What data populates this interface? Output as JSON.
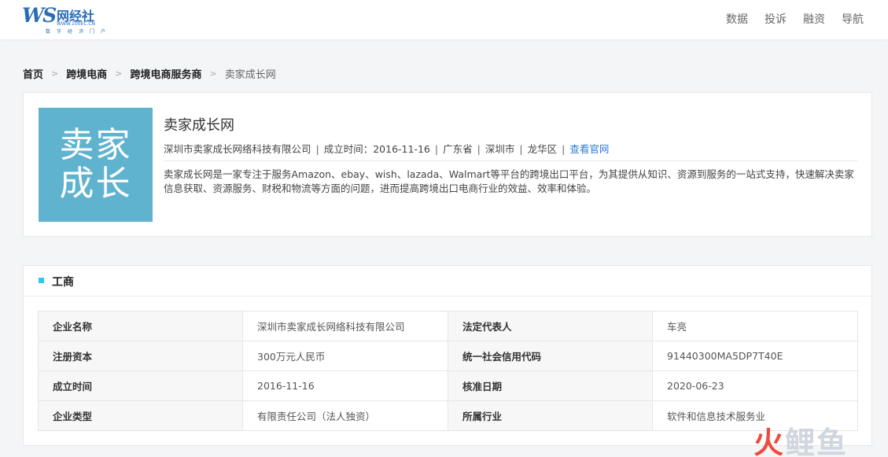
{
  "header": {
    "logo_mark": "WS",
    "logo_cn": "网经社",
    "logo_url": "WWW.100EC.CN",
    "logo_sub": "数字经济门户",
    "nav": [
      "数据",
      "投诉",
      "融资",
      "导航"
    ]
  },
  "breadcrumb": [
    "首页",
    "跨境电商",
    "跨境电商服务商",
    "卖家成长网"
  ],
  "company": {
    "logo_line1": "卖家",
    "logo_line2": "成长",
    "name": "卖家成长网",
    "meta": [
      "深圳市卖家成长网络科技有限公司",
      "成立时间：2016-11-16",
      "广东省",
      "深圳市",
      "龙华区"
    ],
    "website_link": "查看官网",
    "description": "卖家成长网是一家专注于服务Amazon、ebay、wish、lazada、Walmart等平台的跨境出口平台，为其提供从知识、资源到服务的一站式支持，快速解决卖家信息获取、资源服务、财税和物流等方面的问题，进而提高跨境出口电商行业的效益、效率和体验。"
  },
  "business": {
    "title": "工商",
    "rows": [
      [
        "企业名称",
        "深圳市卖家成长网络科技有限公司",
        "法定代表人",
        "车亮"
      ],
      [
        "注册资本",
        "300万元人民币",
        "统一社会信用代码",
        "91440300MA5DP7T40E"
      ],
      [
        "成立时间",
        "2016-11-16",
        "核准日期",
        "2020-06-23"
      ],
      [
        "企业类型",
        "有限责任公司（法人独资）",
        "所属行业",
        "软件和信息技术服务业"
      ]
    ]
  },
  "watermark": {
    "part1": "火",
    "part2": "鲤鱼"
  },
  "colors": {
    "brand": "#2b6db5",
    "link": "#2b7bd6",
    "accent_square": "#2dc7ef",
    "logo_bg": "#5fb3cf"
  }
}
